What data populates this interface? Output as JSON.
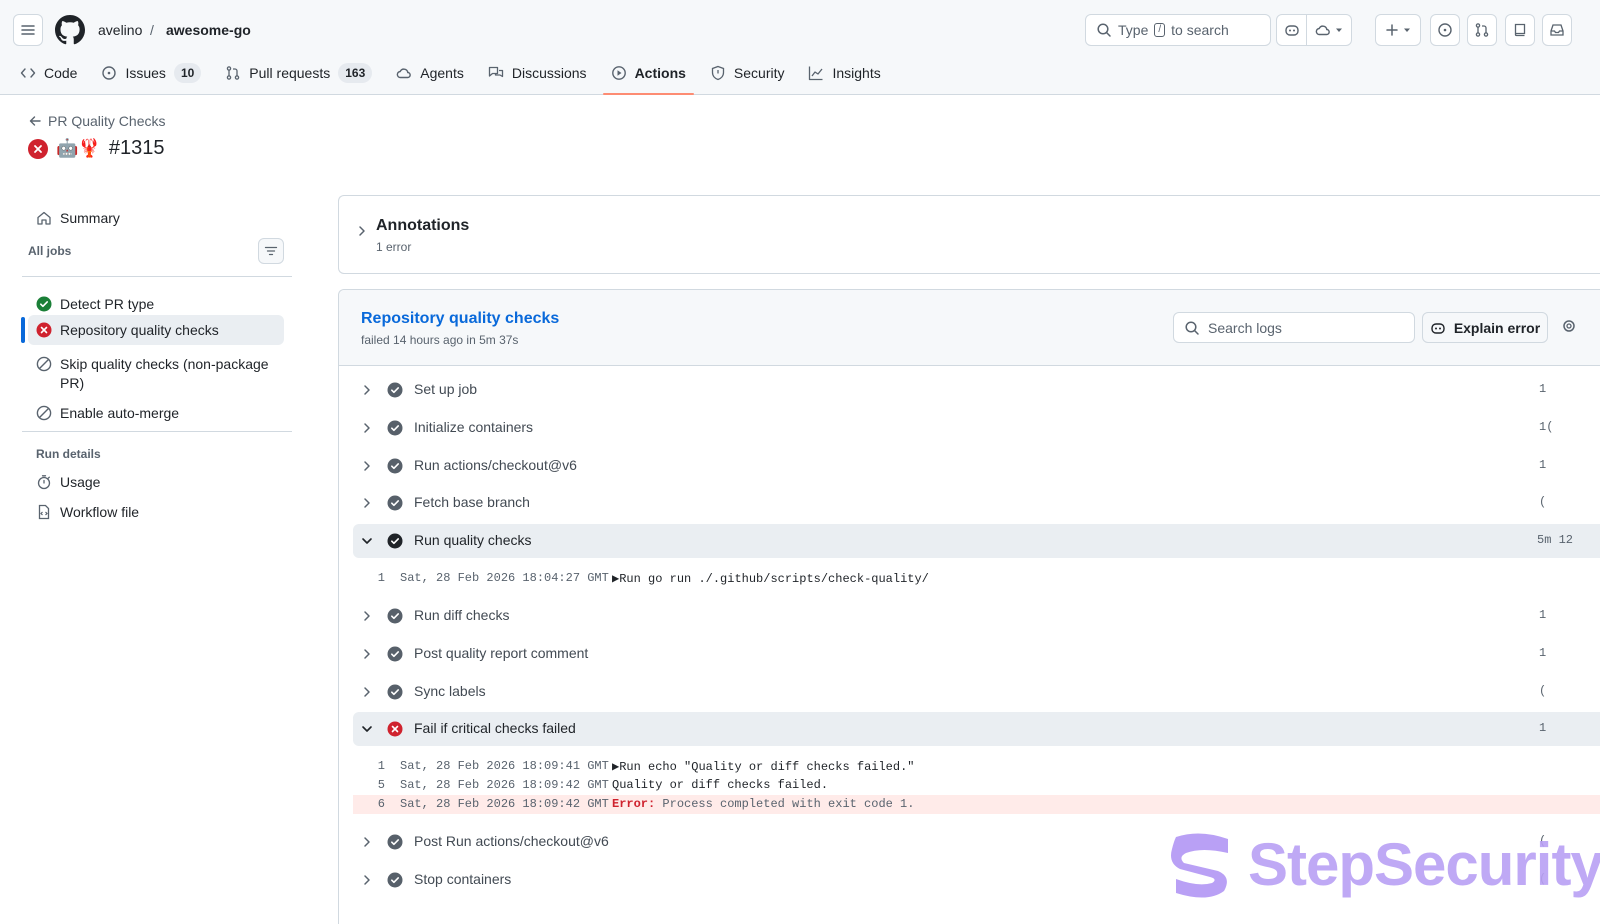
{
  "header": {
    "owner": "avelino",
    "separator": "/",
    "repo": "awesome-go",
    "search_type": "Type",
    "search_key": "/",
    "search_rest": "to search"
  },
  "nav": {
    "code": "Code",
    "issues": "Issues",
    "issues_count": "10",
    "pulls": "Pull requests",
    "pulls_count": "163",
    "agents": "Agents",
    "discussions": "Discussions",
    "actions": "Actions",
    "security": "Security",
    "insights": "Insights"
  },
  "run": {
    "back_label": "PR Quality Checks",
    "emoji": "🤖🦞",
    "number": "#1315",
    "status": "failure"
  },
  "sidebar": {
    "summary": "Summary",
    "all_jobs": "All jobs",
    "jobs": [
      {
        "label": "Detect PR type",
        "status": "success"
      },
      {
        "label": "Repository quality checks",
        "status": "failure",
        "selected": true
      },
      {
        "label": "Skip quality checks (non-package PR)",
        "status": "skipped"
      },
      {
        "label": "Enable auto-merge",
        "status": "skipped"
      }
    ],
    "run_details": "Run details",
    "usage": "Usage",
    "workflow_file": "Workflow file"
  },
  "annotations": {
    "title": "Annotations",
    "subtitle": "1 error"
  },
  "job": {
    "title": "Repository quality checks",
    "subtitle": "failed 14 hours ago in 5m 37s",
    "search_placeholder": "Search logs",
    "explain_label": "Explain error",
    "steps": [
      {
        "label": "Set up job",
        "status": "success",
        "duration": "1"
      },
      {
        "label": "Initialize containers",
        "status": "success",
        "duration": "1("
      },
      {
        "label": "Run actions/checkout@v6",
        "status": "success",
        "duration": "1"
      },
      {
        "label": "Fetch base branch",
        "status": "success",
        "duration": "("
      },
      {
        "label": "Run quality checks",
        "status": "success",
        "duration": "5m 12",
        "expanded": true
      },
      {
        "label": "Run diff checks",
        "status": "success",
        "duration": "1"
      },
      {
        "label": "Post quality report comment",
        "status": "success",
        "duration": "1"
      },
      {
        "label": "Sync labels",
        "status": "success",
        "duration": "("
      },
      {
        "label": "Fail if critical checks failed",
        "status": "failure",
        "duration": "1",
        "expanded": true
      },
      {
        "label": "Post Run actions/checkout@v6",
        "status": "success",
        "duration": "("
      },
      {
        "label": "Stop containers",
        "status": "success",
        "duration": "("
      }
    ],
    "quality_log": [
      {
        "line": "1",
        "time": "Sat, 28 Feb 2026 18:04:27 GMT",
        "text": "▶Run go run ./.github/scripts/check-quality/"
      }
    ],
    "fail_log": [
      {
        "line": "1",
        "time": "Sat, 28 Feb 2026 18:09:41 GMT",
        "text": "▶Run echo \"Quality or diff checks failed.\""
      },
      {
        "line": "5",
        "time": "Sat, 28 Feb 2026 18:09:42 GMT",
        "text": "Quality or diff checks failed."
      },
      {
        "line": "6",
        "time": "Sat, 28 Feb 2026 18:09:42 GMT",
        "error_key": "Error:",
        "error_msg": " Process completed with exit code 1."
      }
    ]
  },
  "watermark": {
    "text": "StepSecurity"
  },
  "colors": {
    "success": "#57606a",
    "success_sidebar": "#1a7f37",
    "failure": "#cf222e",
    "link": "#0969da",
    "active_tab": "#fd8c73",
    "watermark": "#b9a0f5"
  }
}
